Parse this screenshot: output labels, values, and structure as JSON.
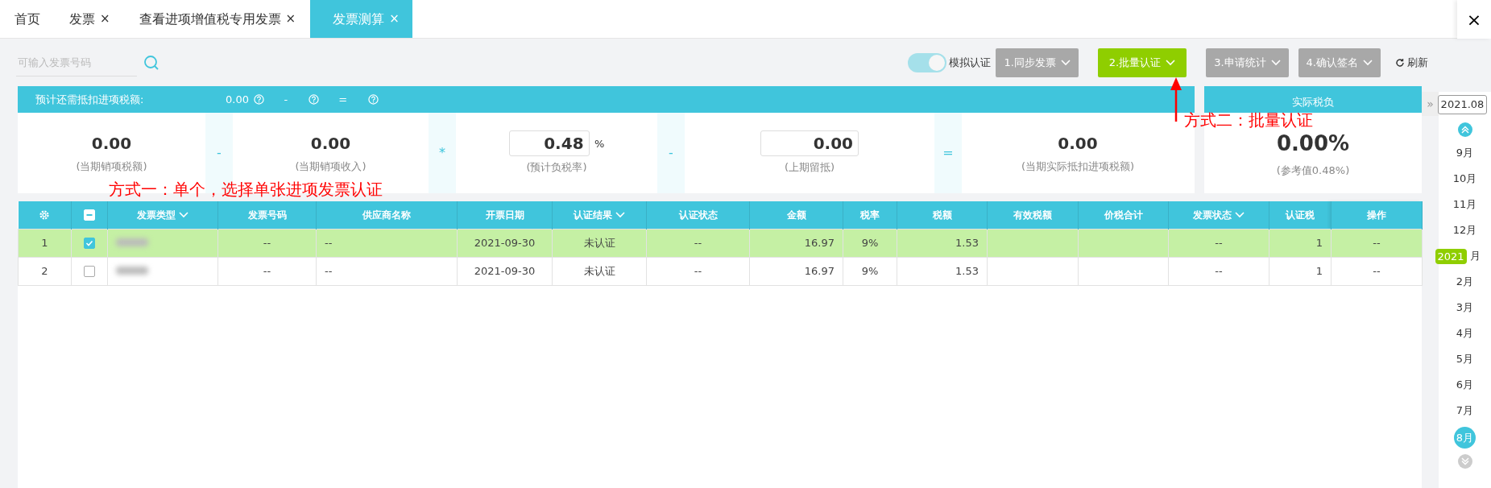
{
  "tabs": [
    {
      "label": "首页",
      "selected": false
    },
    {
      "label": "发票",
      "close": "×",
      "selected": false
    },
    {
      "label": "查看进项增值税专用发票",
      "close": "×",
      "selected": false
    },
    {
      "label": "发票测算",
      "close": "×",
      "selected": true
    }
  ],
  "window_close": "×",
  "search": {
    "placeholder": "可输入发票号码"
  },
  "toolbar": {
    "toggle": {
      "label": "模拟认证",
      "on": true
    },
    "steps": [
      {
        "label": "1.同步发票",
        "selected": false
      },
      {
        "label": "2.批量认证",
        "selected": true
      },
      {
        "label": "3.申请统计",
        "selected": false
      },
      {
        "label": "4.确认签名",
        "selected": false
      }
    ],
    "refresh": "刷新"
  },
  "summary": {
    "header": {
      "label": "预计还需抵扣进项税额:",
      "value": "0.00",
      "operators": [
        "-",
        "="
      ]
    },
    "terms": [
      {
        "kind": "value",
        "value": "0.00",
        "caption": "(当期销项税额)"
      },
      {
        "kind": "operator",
        "symbol": "-"
      },
      {
        "kind": "value",
        "value": "0.00",
        "caption": "(当期销项收入)"
      },
      {
        "kind": "operator",
        "symbol": "*"
      },
      {
        "kind": "input",
        "value": "0.48",
        "unit": "%",
        "caption": "(预计负税率)"
      },
      {
        "kind": "operator",
        "symbol": "-"
      },
      {
        "kind": "input",
        "value": "0.00",
        "caption": "(上期留抵)"
      },
      {
        "kind": "operator",
        "symbol": "="
      },
      {
        "kind": "value",
        "value": "0.00",
        "caption": "(当期实际抵扣进项税额)"
      }
    ]
  },
  "tax_burden": {
    "title": "实际税负",
    "value": "0.00%",
    "caption": "(参考值0.48%)"
  },
  "table": {
    "select_all_partial": true,
    "columns": [
      {
        "kind": "settings"
      },
      {
        "kind": "check"
      },
      {
        "kind": "blurred",
        "label": "发票类型",
        "dropdown": true
      },
      {
        "kind": "text",
        "label": "发票号码",
        "dropdown": false
      },
      {
        "kind": "text",
        "label": "供应商名称",
        "dropdown": false
      },
      {
        "kind": "text",
        "label": "开票日期",
        "dropdown": false
      },
      {
        "kind": "text",
        "label": "认证结果",
        "dropdown": true
      },
      {
        "kind": "text",
        "label": "认证状态",
        "dropdown": false
      },
      {
        "kind": "text",
        "label": "金额",
        "dropdown": false
      },
      {
        "kind": "text",
        "label": "税率",
        "dropdown": false
      },
      {
        "kind": "text",
        "label": "税额",
        "dropdown": false
      },
      {
        "kind": "text",
        "label": "有效税额",
        "dropdown": false
      },
      {
        "kind": "text",
        "label": "价税合计",
        "dropdown": false
      },
      {
        "kind": "text",
        "label": "发票状态",
        "dropdown": true
      },
      {
        "kind": "text",
        "label": "认证税",
        "dropdown": false
      },
      {
        "kind": "text",
        "label": "操作",
        "dropdown": false
      }
    ],
    "rows": [
      {
        "selected": true,
        "checked": true,
        "cells": [
          "1",
          null,
          null,
          "--",
          "--",
          "2021-09-30",
          "未认证",
          "--",
          "16.97",
          "9%",
          "1.53",
          null,
          null,
          "--",
          "1",
          "--"
        ]
      },
      {
        "selected": false,
        "checked": false,
        "cells": [
          "2",
          null,
          null,
          "--",
          "--",
          "2021-09-30",
          "未认证",
          "--",
          "16.97",
          "9%",
          "1.53",
          null,
          null,
          "--",
          "1",
          "--"
        ]
      }
    ]
  },
  "calendar": {
    "collapse": "»",
    "year_box": "2021.08",
    "year_badge": "2021",
    "months": [
      {
        "label": "9月",
        "selected": false,
        "year_marker": false
      },
      {
        "label": "10月",
        "selected": false,
        "year_marker": false
      },
      {
        "label": "11月",
        "selected": false,
        "year_marker": false
      },
      {
        "label": "12月",
        "selected": false,
        "year_marker": false
      },
      {
        "label": "月",
        "selected": false,
        "year_marker": true
      },
      {
        "label": "2月",
        "selected": false,
        "year_marker": false
      },
      {
        "label": "3月",
        "selected": false,
        "year_marker": false
      },
      {
        "label": "4月",
        "selected": false,
        "year_marker": false
      },
      {
        "label": "5月",
        "selected": false,
        "year_marker": false
      },
      {
        "label": "6月",
        "selected": false,
        "year_marker": false
      },
      {
        "label": "7月",
        "selected": false,
        "year_marker": false
      },
      {
        "label": "8月",
        "selected": true,
        "year_marker": false
      }
    ]
  },
  "annotations": [
    {
      "kind": "note",
      "text": "方式一：单个，选择单张进项发票认证"
    },
    {
      "kind": "arrow_note",
      "text": "方式二：批量认证"
    }
  ]
}
